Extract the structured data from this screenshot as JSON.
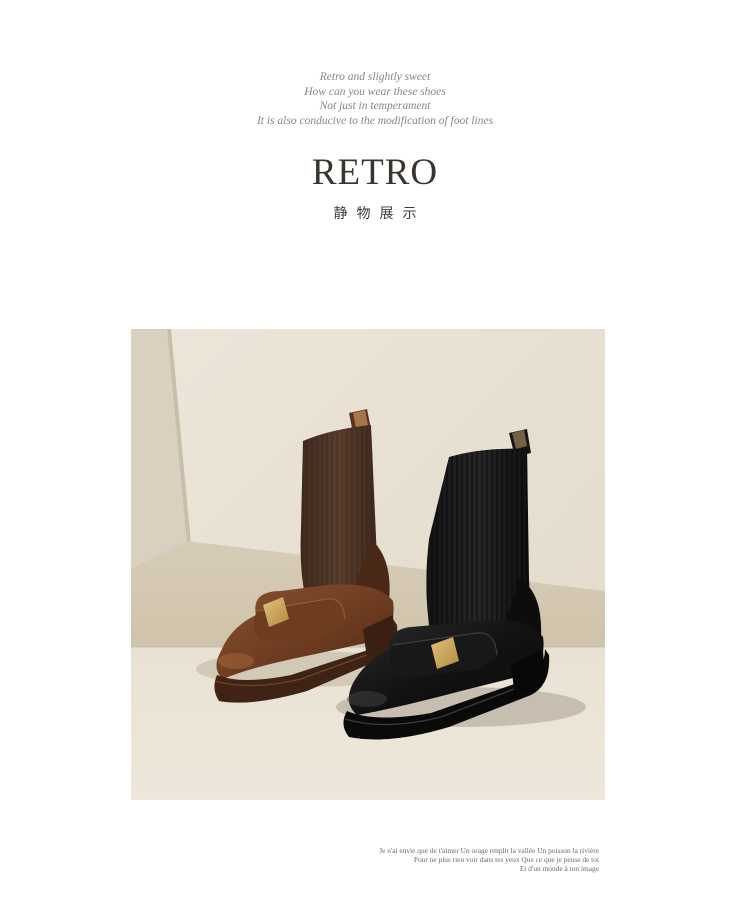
{
  "intro_lines": [
    "Retro and slightly sweet",
    "How can you wear these shoes",
    "Not just in temperament",
    "It is also conducive to the modification of foot lines"
  ],
  "title": "RETRO",
  "subtitle": "静物展示",
  "photo": {
    "subject": "two sock ankle boots with gold square buckles, brown and black"
  },
  "poem_lines": [
    "Je n'ai envie que de t'aimer Un orage emplit la vallée Un poisson la rivière",
    "Pour ne plus rien voir dans tes yeux Que ce que je pense de toi",
    "Et d'un monde à ton image"
  ],
  "colors": {
    "background": "#ffffff",
    "intro_text": "#8b8580",
    "title_text": "#3a342e",
    "backdrop": "#e7e0d2",
    "ledge_top": "#d8cdb8",
    "brown_leather": "#6e3f22",
    "brown_knit": "#4f3527",
    "black_leather": "#141414",
    "buckle_gold": "#c9a45a"
  }
}
